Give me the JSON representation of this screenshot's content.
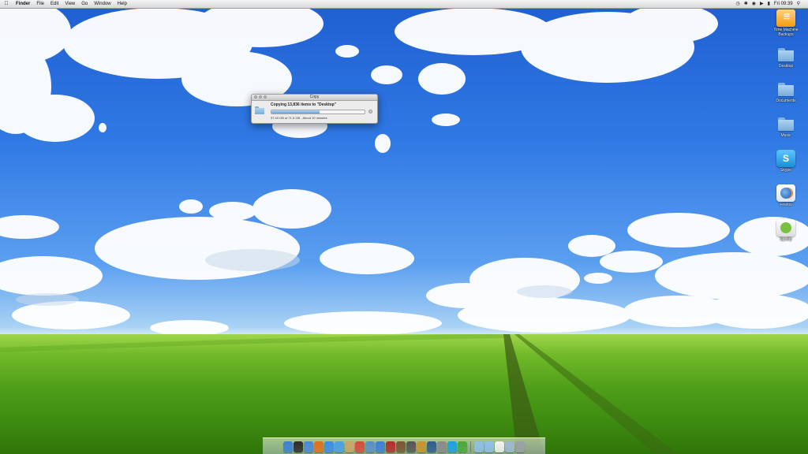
{
  "menubar": {
    "apple_icon": "apple-logo-icon",
    "items": [
      "Finder",
      "File",
      "Edit",
      "View",
      "Go",
      "Window",
      "Help"
    ],
    "clock": "Fri 09:39",
    "status_icons": [
      "time-machine-icon",
      "bluetooth-icon",
      "wifi-icon",
      "volume-icon",
      "battery-icon",
      "spotlight-icon"
    ]
  },
  "desktop_icons": [
    {
      "label": "Time Machine Backups",
      "icon": "external-drive-icon"
    },
    {
      "label": "Desktop",
      "icon": "folder-icon"
    },
    {
      "label": "Documents",
      "icon": "folder-icon"
    },
    {
      "label": "Music",
      "icon": "folder-icon"
    },
    {
      "label": "Skype",
      "icon": "skype-icon"
    },
    {
      "label": "Firefox",
      "icon": "firefox-icon"
    },
    {
      "label": "Spotify",
      "icon": "spotify-icon"
    }
  ],
  "copy_window": {
    "title": "Copy",
    "message": "Copying 13,836 items to \"Desktop\"",
    "status": "37.40 GB of 71.5 GB - About 10 minutes",
    "progress": 0.52
  },
  "dock": {
    "apps": [
      {
        "icon": "finder-icon",
        "color": "#3d7fd6",
        "running": true
      },
      {
        "icon": "dashboard-icon",
        "color": "#2b2b2b",
        "running": false
      },
      {
        "icon": "mail-icon",
        "color": "#4a88d8",
        "running": false
      },
      {
        "icon": "firefox-icon",
        "color": "#e0701c",
        "running": true
      },
      {
        "icon": "safari-icon",
        "color": "#3a8ee6",
        "running": false
      },
      {
        "icon": "ichat-icon",
        "color": "#4aa0e8",
        "running": false
      },
      {
        "icon": "address-book-icon",
        "color": "#c9a56b",
        "running": false
      },
      {
        "icon": "ical-icon",
        "color": "#d84b3b",
        "running": false
      },
      {
        "icon": "iphoto-icon",
        "color": "#5a8fc7",
        "running": false
      },
      {
        "icon": "itunes-icon",
        "color": "#3d7fd6",
        "running": false
      },
      {
        "icon": "photo-booth-icon",
        "color": "#b22c2c",
        "running": false
      },
      {
        "icon": "image-icon",
        "color": "#7a5533",
        "running": false
      },
      {
        "icon": "utilities-icon",
        "color": "#555555",
        "running": false
      },
      {
        "icon": "garageband-icon",
        "color": "#c8932f",
        "running": false
      },
      {
        "icon": "time-machine-icon",
        "color": "#2f5c8f",
        "running": false
      },
      {
        "icon": "system-preferences-icon",
        "color": "#8a8a8a",
        "running": false
      },
      {
        "icon": "skype-icon",
        "color": "#1ba0e1",
        "running": true
      },
      {
        "icon": "spotify-icon",
        "color": "#4aa83a",
        "running": true
      }
    ],
    "stacks": [
      {
        "icon": "folder-icon",
        "color": "#8fbfe6"
      },
      {
        "icon": "folder-icon",
        "color": "#8fbfe6"
      },
      {
        "icon": "document-icon",
        "color": "#f2f2f2"
      },
      {
        "icon": "downloads-icon",
        "color": "#9fb8d0"
      },
      {
        "icon": "trash-icon",
        "color": "#9aa0a6"
      }
    ]
  }
}
